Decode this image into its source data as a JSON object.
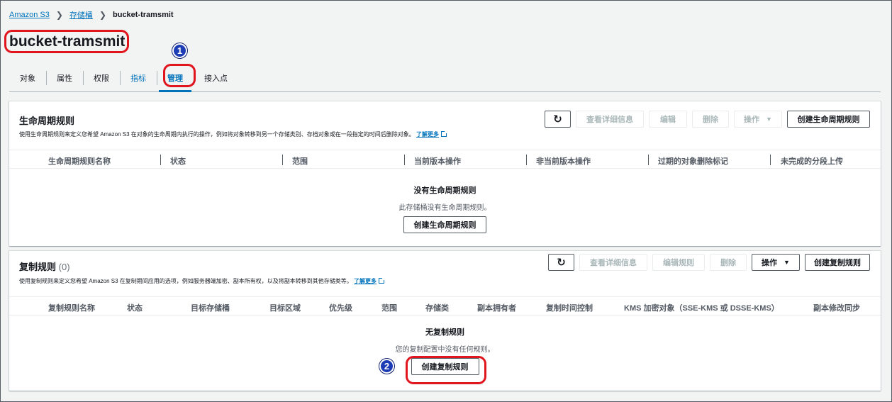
{
  "breadcrumb": {
    "root": "Amazon S3",
    "buckets": "存储桶",
    "current": "bucket-tramsmit"
  },
  "page_title": "bucket-tramsmit",
  "tabs": [
    {
      "label": "对象"
    },
    {
      "label": "属性"
    },
    {
      "label": "权限"
    },
    {
      "label": "指标"
    },
    {
      "label": "管理"
    },
    {
      "label": "接入点"
    }
  ],
  "badges": {
    "step1": "1",
    "step2": "2"
  },
  "lifecycle": {
    "title": "生命周期规则",
    "description": "使用生命周期规则来定义您希望 Amazon S3 在对象的生命周期内执行的操作，例如将对象转移到另一个存储类别、存档对象或在一段指定的时间后删除对象。",
    "learn_more": "了解更多",
    "buttons": {
      "refresh": "↻",
      "view": "查看详细信息",
      "edit": "编辑",
      "delete": "删除",
      "actions": "操作",
      "create": "创建生命周期规则"
    },
    "columns": [
      "生命周期规则名称",
      "状态",
      "范围",
      "当前版本操作",
      "非当前版本操作",
      "过期的对象删除标记",
      "未完成的分段上传"
    ],
    "empty": {
      "title": "没有生命周期规则",
      "subtitle": "此存储桶没有生命周期规则。",
      "button": "创建生命周期规则"
    }
  },
  "replication": {
    "title": "复制规则",
    "count": "(0)",
    "description": "使用复制规则来定义您希望 Amazon S3 在复制期间应用的选项，例如服务器端加密、副本所有权，以及将副本转移到其他存储类等。",
    "learn_more": "了解更多",
    "buttons": {
      "refresh": "↻",
      "view": "查看详细信息",
      "edit": "编辑规则",
      "delete": "删除",
      "actions": "操作",
      "create": "创建复制规则"
    },
    "columns": [
      "复制规则名称",
      "状态",
      "目标存储桶",
      "目标区域",
      "优先级",
      "范围",
      "存储类",
      "副本拥有者",
      "复制时间控制",
      "KMS 加密对象（SSE-KMS 或 DSSE-KMS）",
      "副本修改同步"
    ],
    "empty": {
      "title": "无复制规则",
      "subtitle": "您的复制配置中没有任何规则。",
      "button": "创建复制规则"
    }
  },
  "colors": {
    "accent": "#0073bb",
    "highlight": "#e0151d",
    "badge": "#1c3bb5"
  }
}
